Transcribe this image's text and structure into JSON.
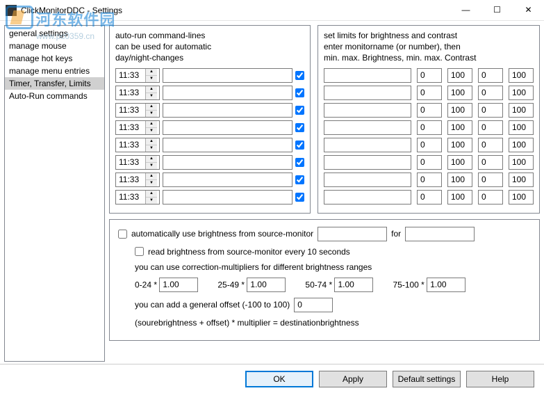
{
  "window": {
    "title": "ClickMonitorDDC - Settings",
    "min": "—",
    "max": "☐",
    "close": "✕"
  },
  "watermark": {
    "cn": "河东软件园",
    "url": "www.pc0359.cn"
  },
  "sidebar": {
    "items": [
      {
        "label": "general settings"
      },
      {
        "label": "manage mouse"
      },
      {
        "label": "manage hot keys"
      },
      {
        "label": "manage menu entries"
      },
      {
        "label": "Timer, Transfer, Limits"
      },
      {
        "label": "Auto-Run commands"
      }
    ],
    "selected": 4
  },
  "leftPanel": {
    "hdr1": "auto-run command-lines",
    "hdr2": "can be used for automatic",
    "hdr3": "day/night-changes",
    "rows": [
      {
        "time": "11:33",
        "cmd": "",
        "checked": true
      },
      {
        "time": "11:33",
        "cmd": "",
        "checked": true
      },
      {
        "time": "11:33",
        "cmd": "",
        "checked": true
      },
      {
        "time": "11:33",
        "cmd": "",
        "checked": true
      },
      {
        "time": "11:33",
        "cmd": "",
        "checked": true
      },
      {
        "time": "11:33",
        "cmd": "",
        "checked": true
      },
      {
        "time": "11:33",
        "cmd": "",
        "checked": true
      },
      {
        "time": "11:33",
        "cmd": "",
        "checked": true
      }
    ]
  },
  "rightPanel": {
    "hdr1": "set limits for brightness and contrast",
    "hdr2": " enter monitorname (or number), then",
    "hdr3": "min. max. Brightness, min. max. Contrast",
    "rows": [
      {
        "name": "",
        "a": "0",
        "b": "100",
        "c": "0",
        "d": "100"
      },
      {
        "name": "",
        "a": "0",
        "b": "100",
        "c": "0",
        "d": "100"
      },
      {
        "name": "",
        "a": "0",
        "b": "100",
        "c": "0",
        "d": "100"
      },
      {
        "name": "",
        "a": "0",
        "b": "100",
        "c": "0",
        "d": "100"
      },
      {
        "name": "",
        "a": "0",
        "b": "100",
        "c": "0",
        "d": "100"
      },
      {
        "name": "",
        "a": "0",
        "b": "100",
        "c": "0",
        "d": "100"
      },
      {
        "name": "",
        "a": "0",
        "b": "100",
        "c": "0",
        "d": "100"
      },
      {
        "name": "",
        "a": "0",
        "b": "100",
        "c": "0",
        "d": "100"
      }
    ]
  },
  "lower": {
    "autoUse": "automatically use brightness from source-monitor",
    "for": "for",
    "read": "read brightness from source-monitor every 10 seconds",
    "corr": "you can use correction-multipliers for different brightness ranges",
    "ranges": [
      {
        "label": "0-24  *",
        "val": "1.00"
      },
      {
        "label": "25-49  *",
        "val": "1.00"
      },
      {
        "label": "50-74  *",
        "val": "1.00"
      },
      {
        "label": "75-100  *",
        "val": "1.00"
      }
    ],
    "offsetLabel": "you can add a general offset (-100 to 100)",
    "offsetVal": "0",
    "formula": "(sourebrightness + offset) * multiplier = destinationbrightness",
    "src": "",
    "dst": ""
  },
  "footer": {
    "ok": "OK",
    "apply": "Apply",
    "defaults": "Default settings",
    "help": "Help"
  }
}
